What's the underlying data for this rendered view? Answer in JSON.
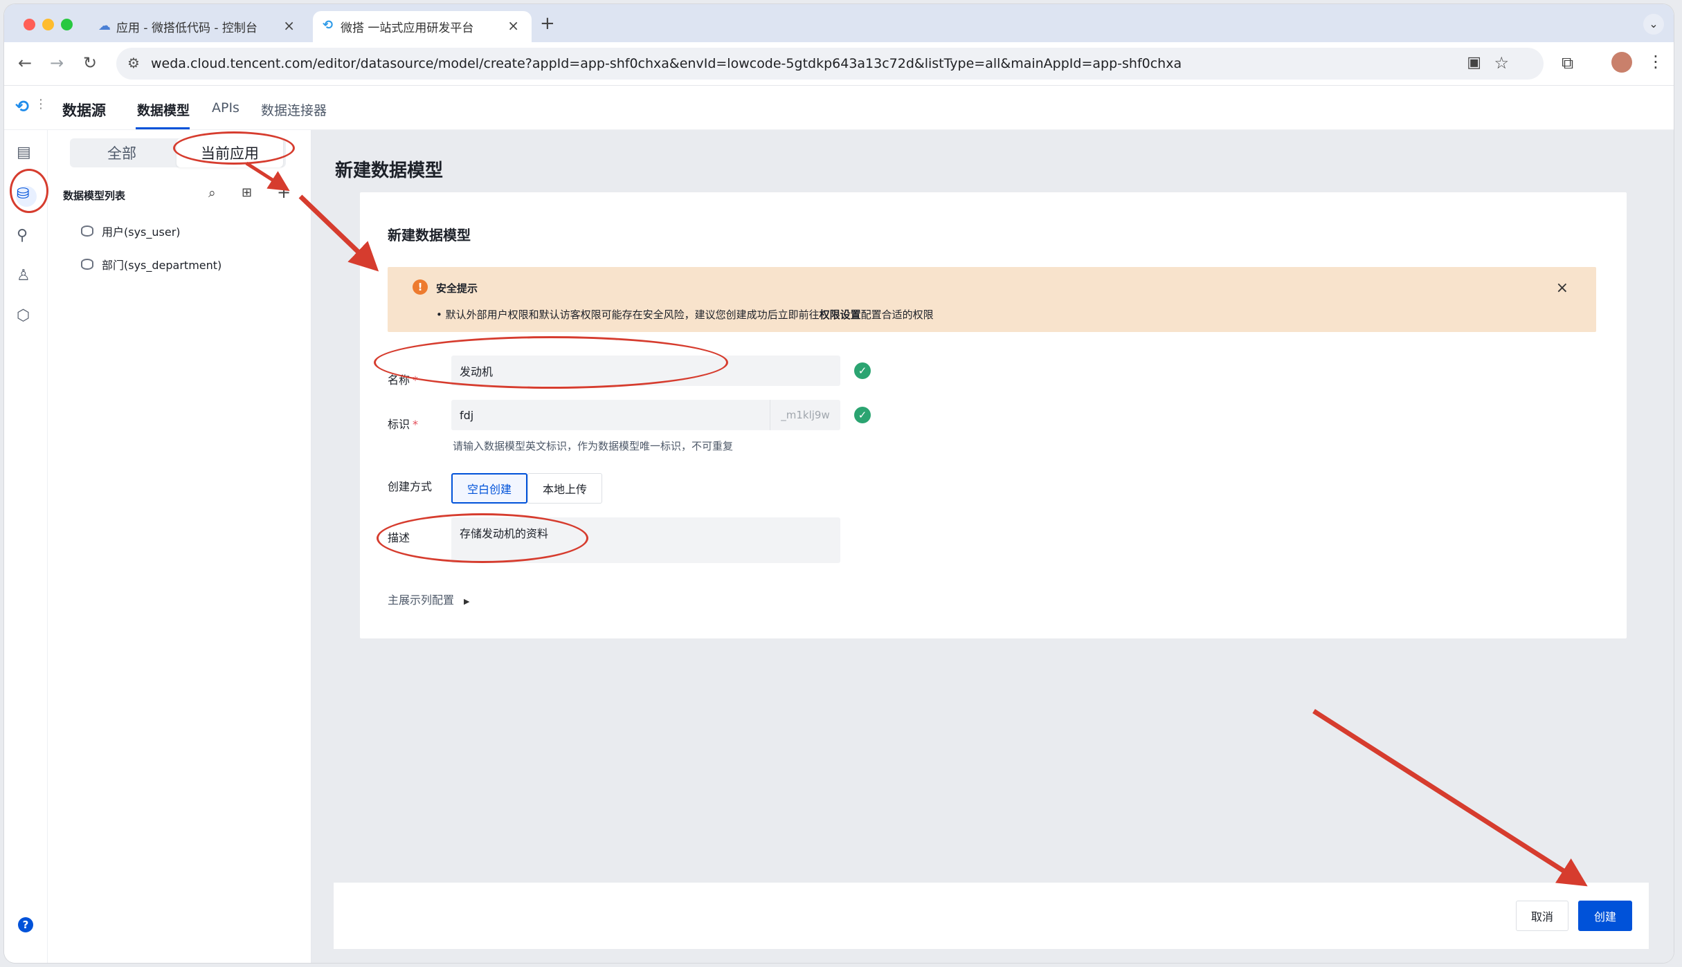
{
  "browser": {
    "tabs": [
      {
        "title": "应用 - 微搭低代码 - 控制台",
        "active": false
      },
      {
        "title": "微搭 一站式应用研发平台",
        "active": true
      }
    ],
    "url": "weda.cloud.tencent.com/editor/datasource/model/create?appId=app-shf0chxa&envId=lowcode-5gtdkp643a13c72d&listType=all&mainAppId=app-shf0chxa"
  },
  "app": {
    "section_title": "数据源",
    "nav_tabs": [
      {
        "label": "数据模型",
        "active": true
      },
      {
        "label": "APIs",
        "active": false
      },
      {
        "label": "数据连接器",
        "active": false
      }
    ],
    "rail_icons": [
      "layout-icon",
      "database-icon",
      "flow-icon",
      "users-icon",
      "settings-hex-icon",
      "help-icon"
    ]
  },
  "sidebar": {
    "segments": [
      {
        "label": "全部",
        "active": false
      },
      {
        "label": "当前应用",
        "active": true
      }
    ],
    "list_title": "数据模型列表",
    "items": [
      {
        "label": "用户(sys_user)"
      },
      {
        "label": "部门(sys_department)"
      }
    ]
  },
  "page": {
    "title": "新建数据模型",
    "card_title": "新建数据模型",
    "alert": {
      "title": "安全提示",
      "text_before": "默认外部用户权限和默认访客权限可能存在安全风险，建议您创建成功后立即前往",
      "text_bold": "权限设置",
      "text_after": "配置合适的权限"
    },
    "form": {
      "name_label": "名称",
      "name_value": "发动机",
      "id_label": "标识",
      "id_value": "fdj",
      "id_suffix": "_m1klj9w",
      "id_hint": "请输入数据模型英文标识，作为数据模型唯一标识，不可重复",
      "method_label": "创建方式",
      "method_options": [
        {
          "label": "空白创建",
          "active": true
        },
        {
          "label": "本地上传",
          "active": false
        }
      ],
      "desc_label": "描述",
      "desc_value": "存储发动机的资料",
      "display_config": "主展示列配置"
    },
    "footer": {
      "cancel": "取消",
      "create": "创建"
    }
  },
  "colors": {
    "primary": "#0052d9",
    "alert_bg": "#f8e3cc",
    "alert_icon": "#ed7b2f",
    "success": "#2ba471",
    "annotation": "#d63c2e"
  }
}
